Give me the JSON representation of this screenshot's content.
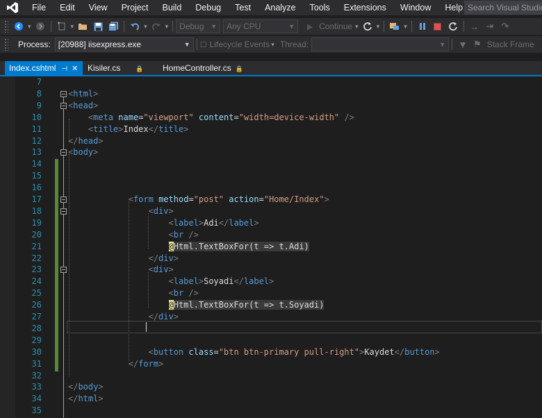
{
  "menu": {
    "items": [
      "File",
      "Edit",
      "View",
      "Project",
      "Build",
      "Debug",
      "Test",
      "Analyze",
      "Tools",
      "Extensions",
      "Window",
      "Help"
    ],
    "search_placeholder": "Search Visual Studio ("
  },
  "toolbar": {
    "config": "Debug",
    "platform": "Any CPU",
    "continue_label": "Continue"
  },
  "debug_toolbar": {
    "process_label": "Process:",
    "process_value": "[20988] iisexpress.exe",
    "lifecycle_label": "Lifecycle Events",
    "thread_label": "Thread:",
    "stack_label": "Stack Frame"
  },
  "tabs": [
    {
      "label": "Index.cshtml",
      "active": true
    },
    {
      "label": "Kisiler.cs",
      "active": false
    },
    {
      "label": "HomeController.cs",
      "active": false
    }
  ],
  "editor": {
    "lines": [
      {
        "n": "7",
        "parts": []
      },
      {
        "n": "8",
        "parts": [
          [
            "punc",
            "<"
          ],
          [
            "tag",
            "html"
          ],
          [
            "punc",
            ">"
          ]
        ]
      },
      {
        "n": "9",
        "parts": [
          [
            "punc",
            "<"
          ],
          [
            "tag",
            "head"
          ],
          [
            "punc",
            ">"
          ]
        ]
      },
      {
        "n": "10",
        "parts": [
          [
            "txt",
            "    "
          ],
          [
            "punc",
            "<"
          ],
          [
            "tag",
            "meta"
          ],
          [
            "txt",
            " "
          ],
          [
            "attr",
            "name"
          ],
          [
            "txt",
            "="
          ],
          [
            "str",
            "\"viewport\""
          ],
          [
            "txt",
            " "
          ],
          [
            "attr",
            "content"
          ],
          [
            "txt",
            "="
          ],
          [
            "str",
            "\"width=device-width\""
          ],
          [
            "txt",
            " "
          ],
          [
            "punc",
            "/>"
          ]
        ]
      },
      {
        "n": "11",
        "parts": [
          [
            "txt",
            "    "
          ],
          [
            "punc",
            "<"
          ],
          [
            "tag",
            "title"
          ],
          [
            "punc",
            ">"
          ],
          [
            "txt",
            "Index"
          ],
          [
            "punc",
            "</"
          ],
          [
            "tag",
            "title"
          ],
          [
            "punc",
            ">"
          ]
        ]
      },
      {
        "n": "12",
        "parts": [
          [
            "punc",
            "</"
          ],
          [
            "tag",
            "head"
          ],
          [
            "punc",
            ">"
          ]
        ]
      },
      {
        "n": "13",
        "parts": [
          [
            "punc",
            "<"
          ],
          [
            "tag",
            "body"
          ],
          [
            "punc",
            ">"
          ]
        ]
      },
      {
        "n": "14",
        "parts": []
      },
      {
        "n": "15",
        "parts": []
      },
      {
        "n": "16",
        "parts": []
      },
      {
        "n": "17",
        "parts": [
          [
            "txt",
            "            "
          ],
          [
            "punc",
            "<"
          ],
          [
            "tag",
            "form"
          ],
          [
            "txt",
            " "
          ],
          [
            "attr",
            "method"
          ],
          [
            "txt",
            "="
          ],
          [
            "str",
            "\"post\""
          ],
          [
            "txt",
            " "
          ],
          [
            "attr",
            "action"
          ],
          [
            "txt",
            "="
          ],
          [
            "str",
            "\"Home/Index\""
          ],
          [
            "punc",
            ">"
          ]
        ]
      },
      {
        "n": "18",
        "parts": [
          [
            "txt",
            "                "
          ],
          [
            "punc",
            "<"
          ],
          [
            "tag",
            "div"
          ],
          [
            "punc",
            ">"
          ]
        ]
      },
      {
        "n": "19",
        "parts": [
          [
            "txt",
            "                    "
          ],
          [
            "punc",
            "<"
          ],
          [
            "tag",
            "label"
          ],
          [
            "punc",
            ">"
          ],
          [
            "txt",
            "Adi"
          ],
          [
            "punc",
            "</"
          ],
          [
            "tag",
            "label"
          ],
          [
            "punc",
            ">"
          ]
        ]
      },
      {
        "n": "20",
        "parts": [
          [
            "txt",
            "                    "
          ],
          [
            "punc",
            "<"
          ],
          [
            "tag",
            "br"
          ],
          [
            "txt",
            " "
          ],
          [
            "punc",
            "/>"
          ]
        ]
      },
      {
        "n": "21",
        "parts": [
          [
            "txt",
            "                    "
          ],
          [
            "razor",
            "@"
          ],
          [
            "rz",
            "Html.TextBoxFor(t => t.Adi)"
          ]
        ]
      },
      {
        "n": "22",
        "parts": [
          [
            "txt",
            "                "
          ],
          [
            "punc",
            "</"
          ],
          [
            "tag",
            "div"
          ],
          [
            "punc",
            ">"
          ]
        ]
      },
      {
        "n": "23",
        "parts": [
          [
            "txt",
            "                "
          ],
          [
            "punc",
            "<"
          ],
          [
            "tag",
            "div"
          ],
          [
            "punc",
            ">"
          ]
        ]
      },
      {
        "n": "24",
        "parts": [
          [
            "txt",
            "                    "
          ],
          [
            "punc",
            "<"
          ],
          [
            "tag",
            "label"
          ],
          [
            "punc",
            ">"
          ],
          [
            "txt",
            "Soyadi"
          ],
          [
            "punc",
            "</"
          ],
          [
            "tag",
            "label"
          ],
          [
            "punc",
            ">"
          ]
        ]
      },
      {
        "n": "25",
        "parts": [
          [
            "txt",
            "                    "
          ],
          [
            "punc",
            "<"
          ],
          [
            "tag",
            "br"
          ],
          [
            "txt",
            " "
          ],
          [
            "punc",
            "/>"
          ]
        ]
      },
      {
        "n": "26",
        "parts": [
          [
            "txt",
            "                    "
          ],
          [
            "razor",
            "@"
          ],
          [
            "rz",
            "Html.TextBoxFor(t => t.Soyadi)"
          ]
        ]
      },
      {
        "n": "27",
        "parts": [
          [
            "txt",
            "                "
          ],
          [
            "punc",
            "</"
          ],
          [
            "tag",
            "div"
          ],
          [
            "punc",
            ">"
          ]
        ]
      },
      {
        "n": "28",
        "parts": []
      },
      {
        "n": "29",
        "parts": []
      },
      {
        "n": "30",
        "parts": [
          [
            "txt",
            "                "
          ],
          [
            "punc",
            "<"
          ],
          [
            "tag",
            "button"
          ],
          [
            "txt",
            " "
          ],
          [
            "attr",
            "class"
          ],
          [
            "txt",
            "="
          ],
          [
            "str",
            "\"btn btn-primary pull-right\""
          ],
          [
            "punc",
            ">"
          ],
          [
            "txt",
            "Kaydet"
          ],
          [
            "punc",
            "</"
          ],
          [
            "tag",
            "button"
          ],
          [
            "punc",
            ">"
          ]
        ]
      },
      {
        "n": "31",
        "parts": [
          [
            "txt",
            "            "
          ],
          [
            "punc",
            "</"
          ],
          [
            "tag",
            "form"
          ],
          [
            "punc",
            ">"
          ]
        ]
      },
      {
        "n": "32",
        "parts": []
      },
      {
        "n": "33",
        "parts": [
          [
            "punc",
            "</"
          ],
          [
            "tag",
            "body"
          ],
          [
            "punc",
            ">"
          ]
        ]
      },
      {
        "n": "34",
        "parts": [
          [
            "punc",
            "</"
          ],
          [
            "tag",
            "html"
          ],
          [
            "punc",
            ">"
          ]
        ]
      },
      {
        "n": "35",
        "parts": []
      }
    ]
  }
}
